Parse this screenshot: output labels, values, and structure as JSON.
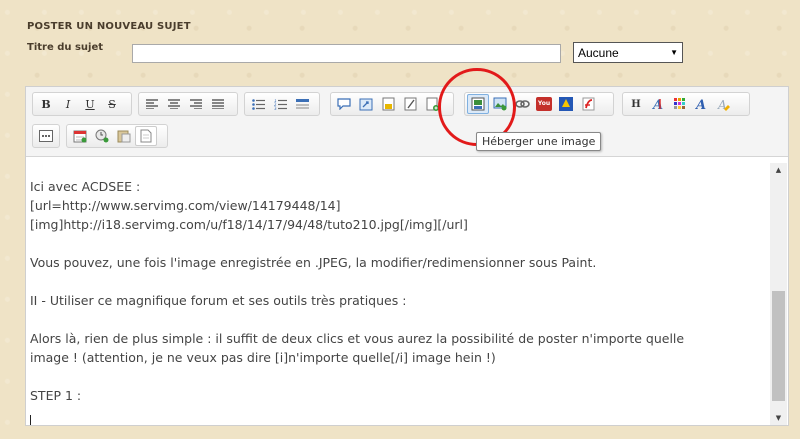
{
  "header": {
    "section_title": "POSTER UN NOUVEAU SUJET",
    "subject_label": "Titre du sujet",
    "subject_value": "",
    "icon_select": {
      "selected": "Aucune"
    }
  },
  "toolbar": {
    "groups": [
      [
        "bold-icon",
        "italic-icon",
        "underline-icon",
        "strikethrough-icon"
      ],
      [
        "align-left-icon",
        "align-center-icon",
        "align-right-icon",
        "justify-icon"
      ],
      [
        "bulleted-list-icon",
        "numbered-list-icon",
        "horizontal-rule-icon"
      ],
      [
        "quote-icon",
        "code-icon",
        "spoiler-icon",
        "hide-icon",
        "add-doc-icon"
      ],
      [
        "host-image-icon",
        "image-icon",
        "link-icon",
        "youtube-icon",
        "dailymotion-icon",
        "flash-icon"
      ],
      [
        "heading-icon",
        "font-icon",
        "color-icon",
        "font-style-icon",
        "clear-format-icon"
      ],
      [
        "more-icon"
      ],
      [
        "date-icon",
        "random-icon",
        "paste-icon",
        "source-icon"
      ]
    ],
    "bold": "B",
    "italic": "I",
    "underline": "U",
    "strike": "S",
    "heading": "H",
    "youtube": "You",
    "tooltip": "Héberger une image"
  },
  "editor": {
    "lines": [
      "Ici avec ACDSEE :",
      "[url=http://www.servimg.com/view/14179448/14]",
      "[img]http://i18.servimg.com/u/f18/14/17/94/48/tuto210.jpg[/img][/url]",
      "",
      "Vous pouvez, une fois l'image enregistrée en .JPEG, la modifier/redimensionner sous Paint.",
      "",
      "II - Utiliser ce magnifique forum et ses outils très pratiques :",
      "",
      "Alors là, rien de plus simple : il suffit de deux clics et vous aurez la possibilité de poster n'importe quelle",
      "image ! (attention, je ne veux pas dire [i]n'importe quelle[/i] image hein !)",
      "",
      "STEP 1 :"
    ]
  },
  "colors": {
    "background": "#efe3c6",
    "highlight": "#e21a1a",
    "active_button": "#dbe9f8"
  }
}
